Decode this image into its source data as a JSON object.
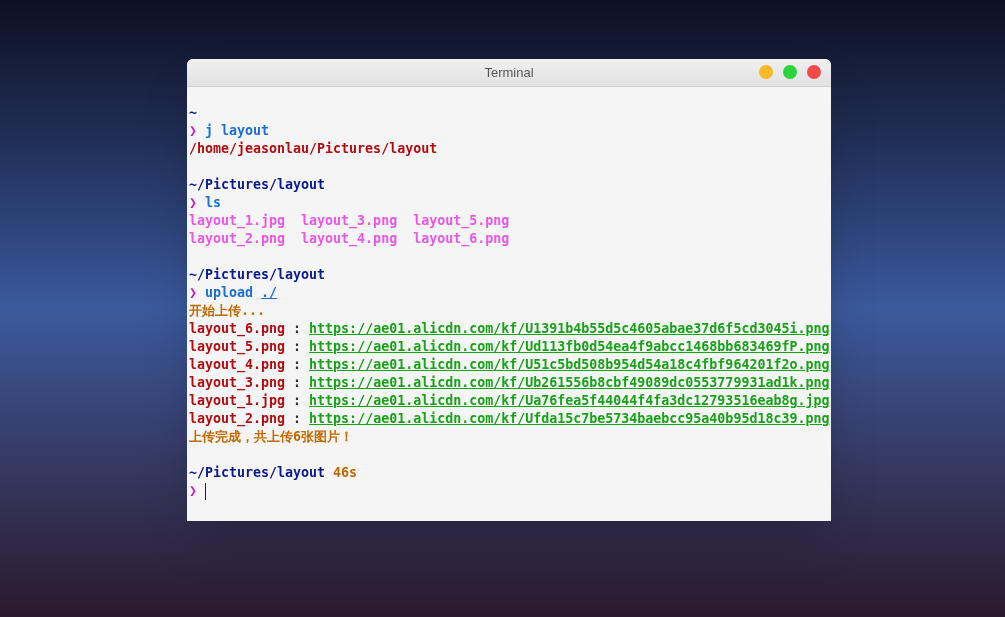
{
  "window": {
    "title": "Terminal"
  },
  "blocks": [
    {
      "lines": [
        [
          {
            "kind": "dir",
            "text": "~"
          }
        ],
        [
          {
            "kind": "arrow",
            "text": "❯"
          },
          {
            "kind": "command",
            "text": "j layout"
          }
        ],
        [
          {
            "kind": "path",
            "text": "/home/jeasonlau/Pictures/layout"
          }
        ]
      ]
    },
    {
      "lines": [
        [
          {
            "kind": "dir",
            "text": "~/Pictures/layout"
          }
        ],
        [
          {
            "kind": "arrow",
            "text": "❯"
          },
          {
            "kind": "command",
            "text": "ls"
          }
        ],
        [
          {
            "kind": "listing",
            "text": "layout_1.jpg  layout_3.png  layout_5.png"
          }
        ],
        [
          {
            "kind": "listing",
            "text": "layout_2.png  layout_4.png  layout_6.png"
          }
        ]
      ]
    },
    {
      "lines": [
        [
          {
            "kind": "dir",
            "text": "~/Pictures/layout"
          }
        ],
        [
          {
            "kind": "arrow",
            "text": "❯"
          },
          {
            "kind": "command",
            "text": "upload"
          },
          {
            "kind": "argument",
            "text": "./"
          }
        ],
        [
          {
            "kind": "message",
            "text": "开始上传..."
          }
        ],
        [
          {
            "kind": "file",
            "text": "layout_6.png"
          },
          {
            "kind": "separator",
            "text": ":"
          },
          {
            "kind": "link",
            "text": "https://ae01.alicdn.com/kf/U1391b4b55d5c4605abae37d6f5cd3045i.png"
          }
        ],
        [
          {
            "kind": "file",
            "text": "layout_5.png"
          },
          {
            "kind": "separator",
            "text": ":"
          },
          {
            "kind": "link",
            "text": "https://ae01.alicdn.com/kf/Ud113fb0d54ea4f9abcc1468bb683469fP.png"
          }
        ],
        [
          {
            "kind": "file",
            "text": "layout_4.png"
          },
          {
            "kind": "separator",
            "text": ":"
          },
          {
            "kind": "link",
            "text": "https://ae01.alicdn.com/kf/U51c5bd508b954d54a18c4fbf964201f2o.png"
          }
        ],
        [
          {
            "kind": "file",
            "text": "layout_3.png"
          },
          {
            "kind": "separator",
            "text": ":"
          },
          {
            "kind": "link",
            "text": "https://ae01.alicdn.com/kf/Ub261556b8cbf49089dc0553779931ad1k.png"
          }
        ],
        [
          {
            "kind": "file",
            "text": "layout_1.jpg"
          },
          {
            "kind": "separator",
            "text": ":"
          },
          {
            "kind": "link",
            "text": "https://ae01.alicdn.com/kf/Ua76fea5f44044f4fa3dc12793516eab8g.jpg"
          }
        ],
        [
          {
            "kind": "file",
            "text": "layout_2.png"
          },
          {
            "kind": "separator",
            "text": ":"
          },
          {
            "kind": "link",
            "text": "https://ae01.alicdn.com/kf/Ufda15c7be5734baebcc95a40b95d18c39.png"
          }
        ],
        [
          {
            "kind": "message",
            "text": "上传完成，共上传6张图片！"
          }
        ]
      ]
    },
    {
      "lines": [
        [
          {
            "kind": "dir",
            "text": "~/Pictures/layout"
          },
          {
            "kind": "duration",
            "text": "46s"
          }
        ],
        [
          {
            "kind": "arrow",
            "text": "❯"
          },
          {
            "kind": "cursor"
          }
        ]
      ]
    }
  ]
}
